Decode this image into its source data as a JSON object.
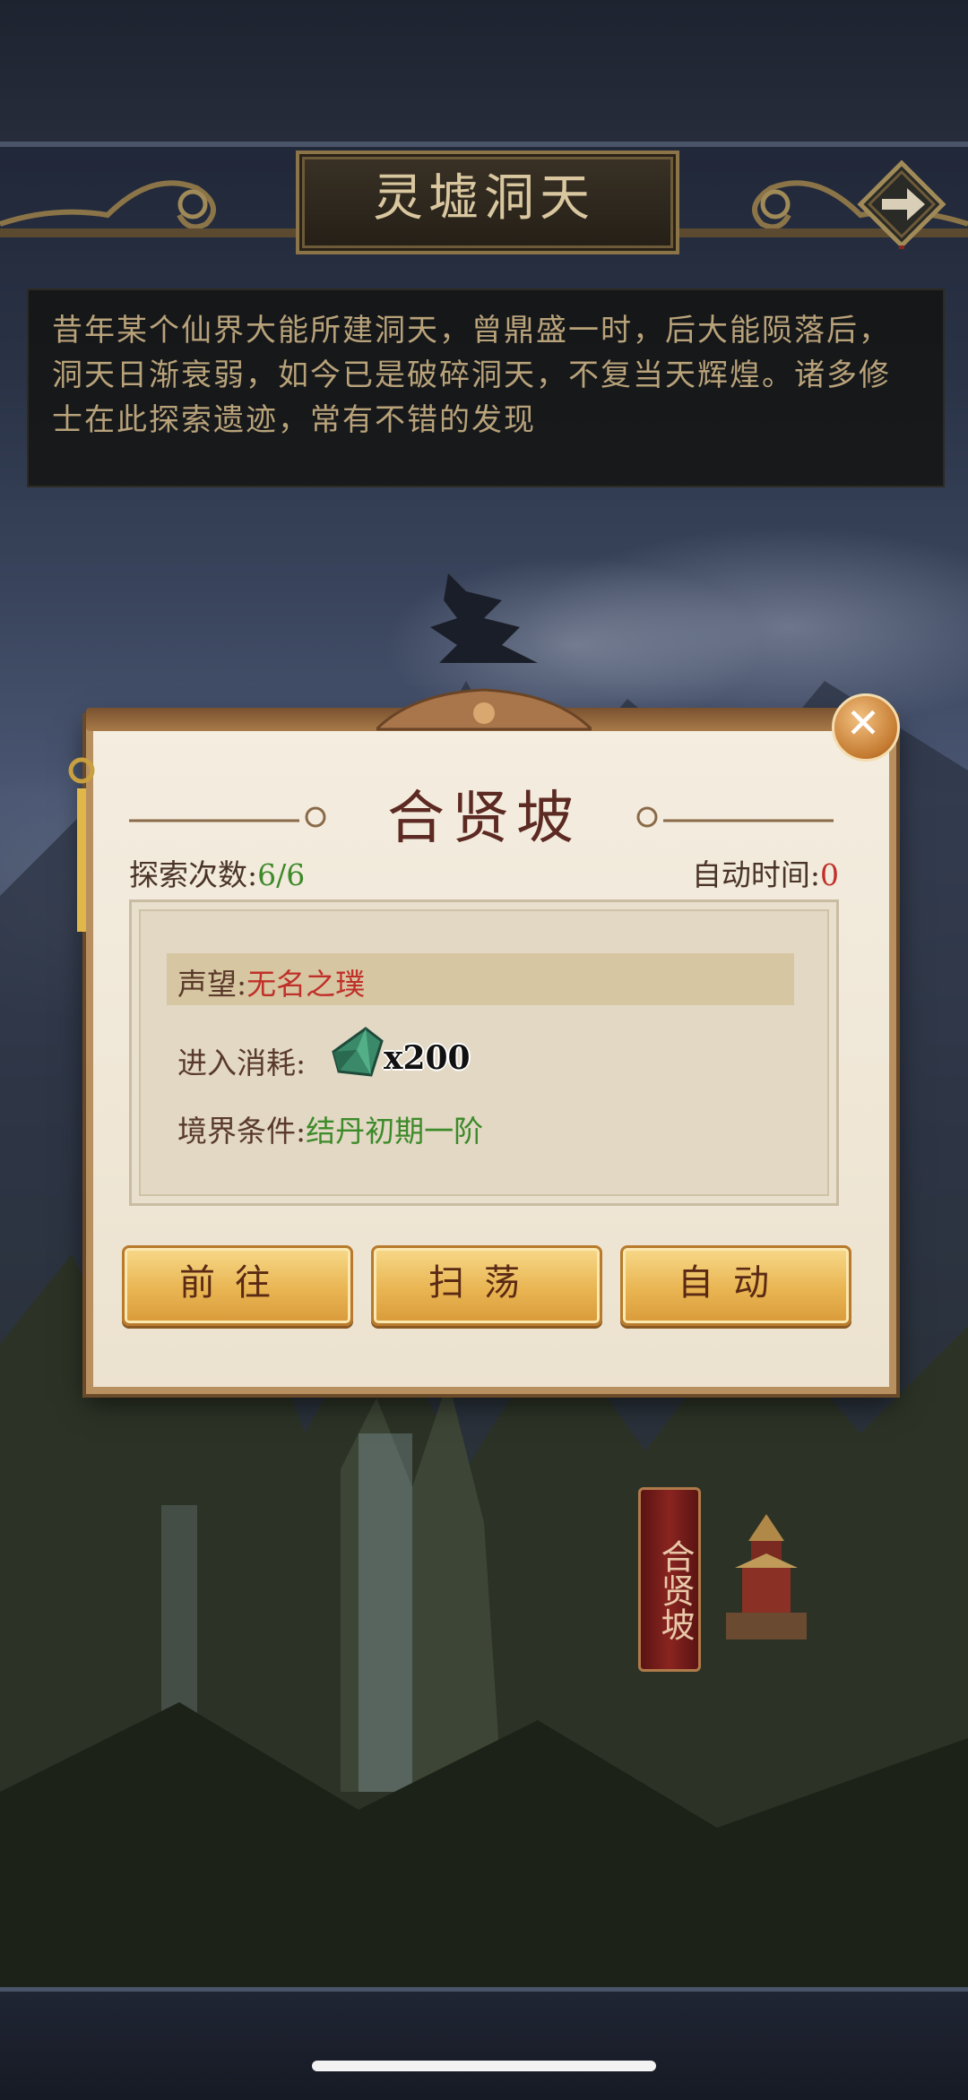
{
  "location": {
    "title": "灵墟洞天",
    "description": "昔年某个仙界大能所建洞天，曾鼎盛一时，后大能陨落后，洞天日渐衰弱，如今已是破碎洞天，不复当天辉煌。诸多修士在此探索遗迹，常有不错的发现"
  },
  "map_marker": {
    "label": "合贤坡"
  },
  "dialog": {
    "title": "合贤坡",
    "explore_label": "探索次数:",
    "explore_value": "6/6",
    "auto_time_label": "自动时间:",
    "auto_time_value": "0",
    "reputation_label": "声望:",
    "reputation_value": "无名之璞",
    "cost_label": "进入消耗:",
    "cost_qty": "x200",
    "realm_label": "境界条件:",
    "realm_value": "结丹初期一阶",
    "buttons": {
      "go": "前往",
      "sweep": "扫荡",
      "auto": "自动"
    },
    "close": "✕"
  },
  "colors": {
    "accent_green": "#3d8a2a",
    "accent_red": "#c0302a",
    "dialog_title": "#5c2a22",
    "button_gold": "#e9b552"
  },
  "icons": [
    "arrow-right-icon",
    "close-icon",
    "gem-icon",
    "pagoda-icon"
  ]
}
